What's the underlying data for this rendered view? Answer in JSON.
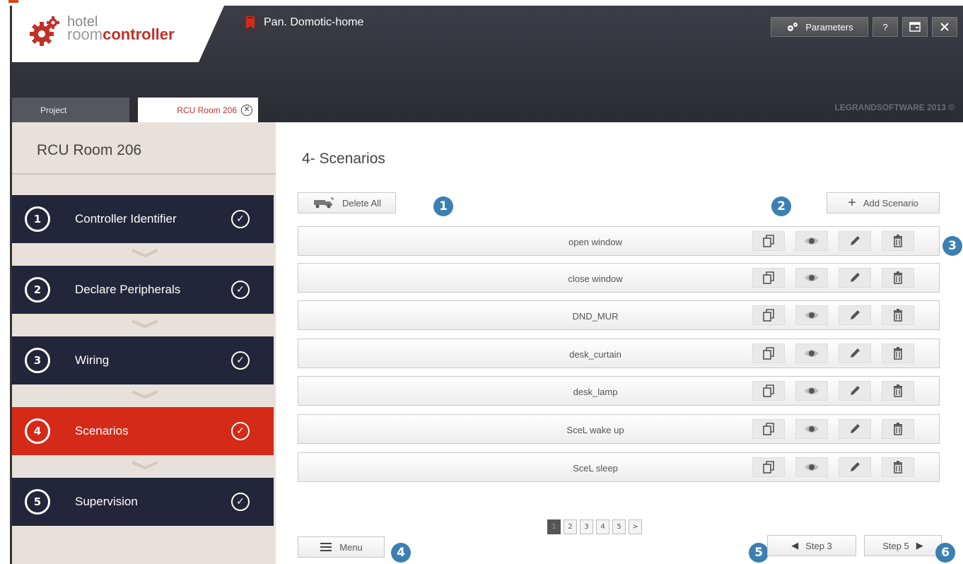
{
  "app": {
    "logo_line1": "hotel",
    "logo_room": "room",
    "logo_controller": "controller",
    "project_name": "Pan. Domotic-home",
    "copyright": "LEGRANDSOFTWARE 2013 ©"
  },
  "header_buttons": {
    "parameters": "Parameters",
    "help": "?"
  },
  "tabs": [
    {
      "label": "Project"
    },
    {
      "label": "RCU Room 206"
    }
  ],
  "sidebar": {
    "title": "RCU Room 206",
    "steps": [
      {
        "number": "1",
        "label": "Controller Identifier"
      },
      {
        "number": "2",
        "label": "Declare Peripherals"
      },
      {
        "number": "3",
        "label": "Wiring"
      },
      {
        "number": "4",
        "label": "Scenarios"
      },
      {
        "number": "5",
        "label": "Supervision"
      }
    ]
  },
  "main": {
    "title": "4- Scenarios",
    "delete_all": "Delete All",
    "add_scenario": "Add Scenario",
    "scenarios": [
      {
        "name": "open window"
      },
      {
        "name": "close window"
      },
      {
        "name": "DND_MUR"
      },
      {
        "name": "desk_curtain"
      },
      {
        "name": "desk_lamp"
      },
      {
        "name": "SceL wake up"
      },
      {
        "name": "SceL sleep"
      }
    ],
    "pages": [
      "1",
      "2",
      "3",
      "4",
      "5",
      ">"
    ],
    "menu": "Menu",
    "prev_step": "Step 3",
    "next_step": "Step 5"
  },
  "callouts": [
    "1",
    "2",
    "3",
    "4",
    "5",
    "6"
  ],
  "colors": {
    "accent_red": "#d42a17",
    "dark_navy": "#23253a",
    "callout_blue": "#3c7fb3"
  }
}
